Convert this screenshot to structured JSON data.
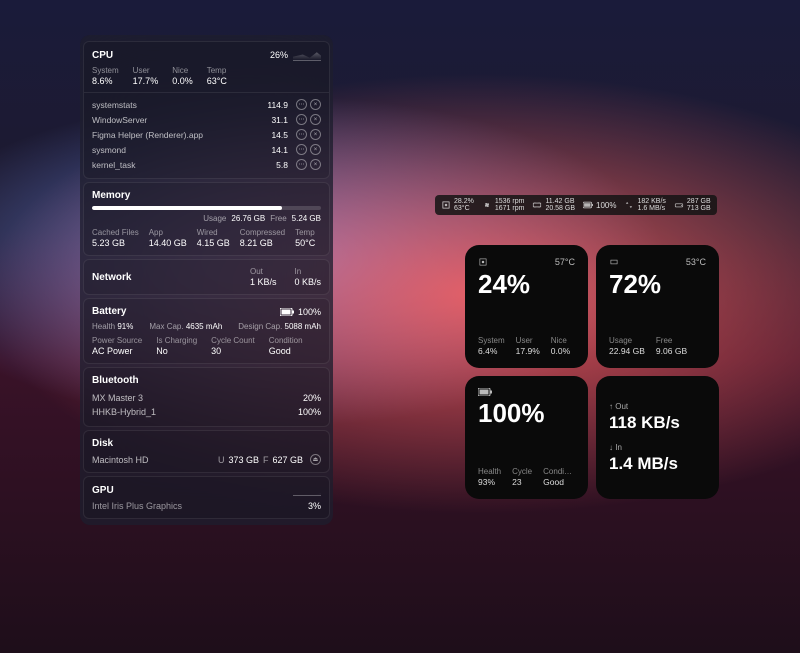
{
  "cpu": {
    "title": "CPU",
    "pct": "26%",
    "sub": [
      [
        "System",
        "8.6%"
      ],
      [
        "User",
        "17.7%"
      ],
      [
        "Nice",
        "0.0%"
      ],
      [
        "Temp",
        "63°C"
      ]
    ],
    "procs": [
      [
        "systemstats",
        "114.9"
      ],
      [
        "WindowServer",
        "31.1"
      ],
      [
        "Figma Helper (Renderer).app",
        "14.5"
      ],
      [
        "sysmond",
        "14.1"
      ],
      [
        "kernel_task",
        "5.8"
      ]
    ]
  },
  "mem": {
    "title": "Memory",
    "usage_l": "Usage",
    "usage": "26.76 GB",
    "free_l": "Free",
    "free": "5.24 GB",
    "bar": 83,
    "sub": [
      [
        "Cached Files",
        "5.23 GB"
      ],
      [
        "App",
        "14.40 GB"
      ],
      [
        "Wired",
        "4.15 GB"
      ],
      [
        "Compressed",
        "8.21 GB"
      ],
      [
        "Temp",
        "50°C"
      ]
    ]
  },
  "net": {
    "title": "Network",
    "out_l": "Out",
    "out": "1 KB/s",
    "in_l": "In",
    "in": "0 KB/s"
  },
  "bat": {
    "title": "Battery",
    "pct": "100%",
    "row": [
      [
        "Health",
        "91%"
      ],
      [
        "Max Cap.",
        "4635 mAh"
      ],
      [
        "Design Cap.",
        "5088 mAh"
      ]
    ],
    "sub": [
      [
        "Power Source",
        "AC Power"
      ],
      [
        "Is Charging",
        "No"
      ],
      [
        "Cycle Count",
        "30"
      ],
      [
        "Condition",
        "Good"
      ]
    ]
  },
  "bt": {
    "title": "Bluetooth",
    "devs": [
      [
        "MX Master 3",
        "20%"
      ],
      [
        "HHKB-Hybrid_1",
        "100%"
      ]
    ]
  },
  "disk": {
    "title": "Disk",
    "name": "Macintosh HD",
    "u_l": "U",
    "u": "373 GB",
    "f_l": "F",
    "f": "627 GB"
  },
  "gpu": {
    "title": "GPU",
    "name": "Intel Iris Plus Graphics",
    "pct": "3%"
  },
  "mb": {
    "cpu1": "28.2%",
    "cpu2": "63°C",
    "fan1": "1536 rpm",
    "fan2": "1671 rpm",
    "mem1": "11.42 GB",
    "mem2": "20.58 GB",
    "bat": "100%",
    "n1": "182 KB/s",
    "n2": "1.6 MB/s",
    "d1": "287 GB",
    "d2": "713 GB"
  },
  "w": {
    "cpu": {
      "temp": "57°C",
      "big": "24%",
      "sub": [
        [
          "System",
          "6.4%"
        ],
        [
          "User",
          "17.9%"
        ],
        [
          "Nice",
          "0.0%"
        ]
      ]
    },
    "mem": {
      "temp": "53°C",
      "big": "72%",
      "sub": [
        [
          "Usage",
          "22.94 GB"
        ],
        [
          "Free",
          "9.06 GB"
        ]
      ]
    },
    "bat": {
      "big": "100%",
      "sub": [
        [
          "Health",
          "93%"
        ],
        [
          "Cycle",
          "23"
        ],
        [
          "Condi…",
          "Good"
        ]
      ]
    },
    "net": {
      "out_l": "Out",
      "out": "118 KB/s",
      "in_l": "In",
      "in": "1.4 MB/s"
    }
  }
}
